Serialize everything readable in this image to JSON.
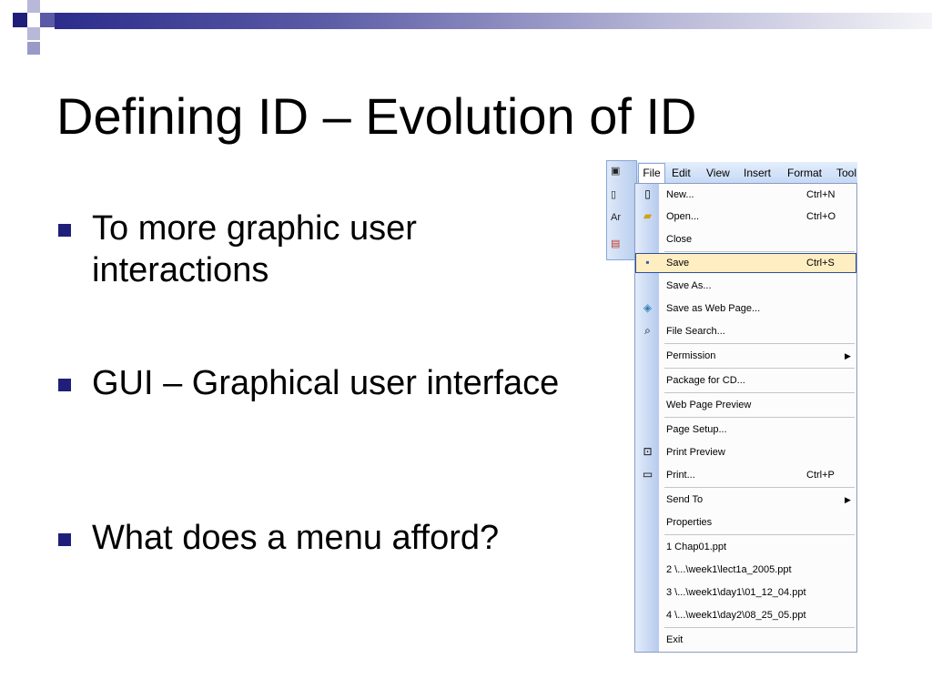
{
  "slide": {
    "title": "Defining ID – Evolution of ID",
    "bullets": [
      "To more graphic user interactions",
      "GUI – Graphical user interface",
      "What does a menu afford?"
    ]
  },
  "menu_screenshot": {
    "menubar": [
      "File",
      "Edit",
      "View",
      "Insert",
      "Format",
      "Tool"
    ],
    "toolbar_fragments": [
      "Ar"
    ],
    "items": [
      {
        "label": "New...",
        "shortcut": "Ctrl+N",
        "icon": "new-document-icon"
      },
      {
        "label": "Open...",
        "shortcut": "Ctrl+O",
        "icon": "open-folder-icon"
      },
      {
        "label": "Close",
        "shortcut": ""
      },
      {
        "label": "Save",
        "shortcut": "Ctrl+S",
        "icon": "save-disk-icon",
        "highlighted": true
      },
      {
        "label": "Save As...",
        "shortcut": ""
      },
      {
        "label": "Save as Web Page...",
        "shortcut": "",
        "icon": "web-page-icon"
      },
      {
        "label": "File Search...",
        "shortcut": "",
        "icon": "file-search-icon"
      },
      {
        "label": "Permission",
        "shortcut": "",
        "submenu": true
      },
      {
        "label": "Package for CD...",
        "shortcut": ""
      },
      {
        "label": "Web Page Preview",
        "shortcut": ""
      },
      {
        "label": "Page Setup...",
        "shortcut": ""
      },
      {
        "label": "Print Preview",
        "shortcut": "",
        "icon": "print-preview-icon"
      },
      {
        "label": "Print...",
        "shortcut": "Ctrl+P",
        "icon": "printer-icon"
      },
      {
        "label": "Send To",
        "shortcut": "",
        "submenu": true
      },
      {
        "label": "Properties",
        "shortcut": ""
      },
      {
        "label": "1 Chap01.ppt",
        "shortcut": ""
      },
      {
        "label": "2 \\...\\week1\\lect1a_2005.ppt",
        "shortcut": ""
      },
      {
        "label": "3 \\...\\week1\\day1\\01_12_04.ppt",
        "shortcut": ""
      },
      {
        "label": "4 \\...\\week1\\day2\\08_25_05.ppt",
        "shortcut": ""
      },
      {
        "label": "Exit",
        "shortcut": ""
      }
    ]
  },
  "colors": {
    "bullet": "#1f1f7a",
    "highlight": "#ffeec2",
    "highlight_border": "#2f4f9a"
  }
}
